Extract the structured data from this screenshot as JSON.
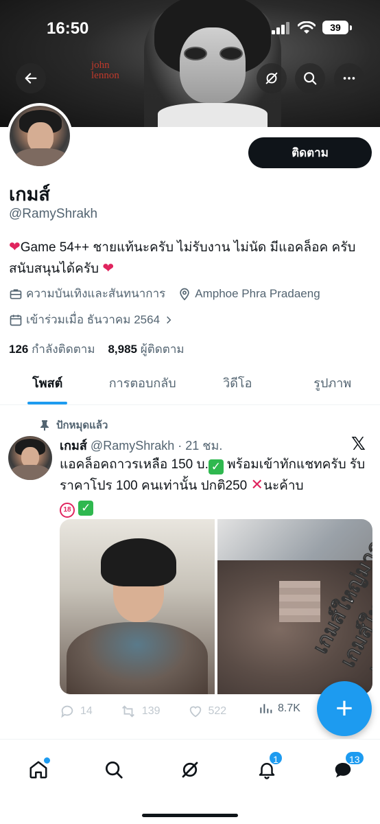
{
  "status_bar": {
    "time": "16:50",
    "battery": "39"
  },
  "banner": {
    "caption_line1": "john",
    "caption_line2": "lennon"
  },
  "profile": {
    "follow_label": "ติดตาม",
    "name": "เกมส์",
    "handle": "@RamyShrakh",
    "bio_before_heart": "Game 54++ ชายแท้นะครับ ไม่รับงาน ไม่นัด มีแอคล็อค ครับ สนับสนุนได้ครับ",
    "category": "ความบันเทิงและสันทนาการ",
    "location": "Amphoe Phra Pradaeng",
    "joined": "เข้าร่วมเมื่อ ธันวาคม 2564",
    "following_count": "126",
    "following_label": "กำลังติดตาม",
    "followers_count": "8,985",
    "followers_label": "ผู้ติดตาม"
  },
  "tabs": [
    {
      "label": "โพสต์",
      "active": true
    },
    {
      "label": "การตอบกลับ",
      "active": false
    },
    {
      "label": "วิดีโอ",
      "active": false
    },
    {
      "label": "รูปภาพ",
      "active": false
    }
  ],
  "post": {
    "pinned_label": "ปักหมุดแล้ว",
    "author_name": "เกมส์",
    "author_handle": "@RamyShrakh",
    "time": "· 21 ชม.",
    "text_part1": "แอคล็อคถาวรเหลือ 150 บ.",
    "text_part2": " พร้อมเข้าทักแชทครับ รับราคาโปร 100 คนเท่านั้น ปกติ250 ",
    "text_part3": "นะค้าบ",
    "watermark": "เกมส์ใหญ่มาก",
    "stats": {
      "replies": "14",
      "reposts": "139",
      "likes": "522",
      "views": "8.7K"
    }
  },
  "bottom_nav": {
    "notifications_badge": "1",
    "messages_badge": "13"
  },
  "colors": {
    "accent": "#1d9bf0",
    "text": "#0f1419",
    "muted": "#536471"
  }
}
